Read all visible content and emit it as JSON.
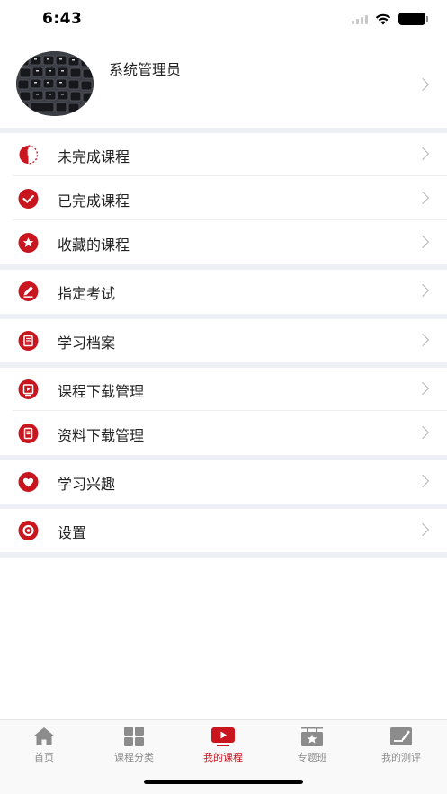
{
  "status_bar": {
    "time": "6:43"
  },
  "profile": {
    "name": "系统管理员"
  },
  "menu": {
    "incomplete": "未完成课程",
    "completed": "已完成课程",
    "favorites": "收藏的课程",
    "assigned_exam": "指定考试",
    "study_record": "学习档案",
    "course_download": "课程下载管理",
    "material_download": "资料下载管理",
    "interests": "学习兴趣",
    "settings": "设置"
  },
  "tabbar": {
    "home": "首页",
    "category": "课程分类",
    "my_courses": "我的课程",
    "special_class": "专题班",
    "my_tests": "我的测评"
  },
  "colors": {
    "accent": "#c9151e",
    "separator": "#eff0f6",
    "tab_inactive": "#8c8c8c"
  },
  "icons": {
    "incomplete": "half-circle-icon",
    "completed": "check-circle-icon",
    "favorites": "star-circle-icon",
    "assigned_exam": "pencil-circle-icon",
    "study_record": "document-icon",
    "course_download": "video-download-icon",
    "material_download": "file-icon",
    "interests": "heart-icon",
    "settings": "gear-icon"
  }
}
